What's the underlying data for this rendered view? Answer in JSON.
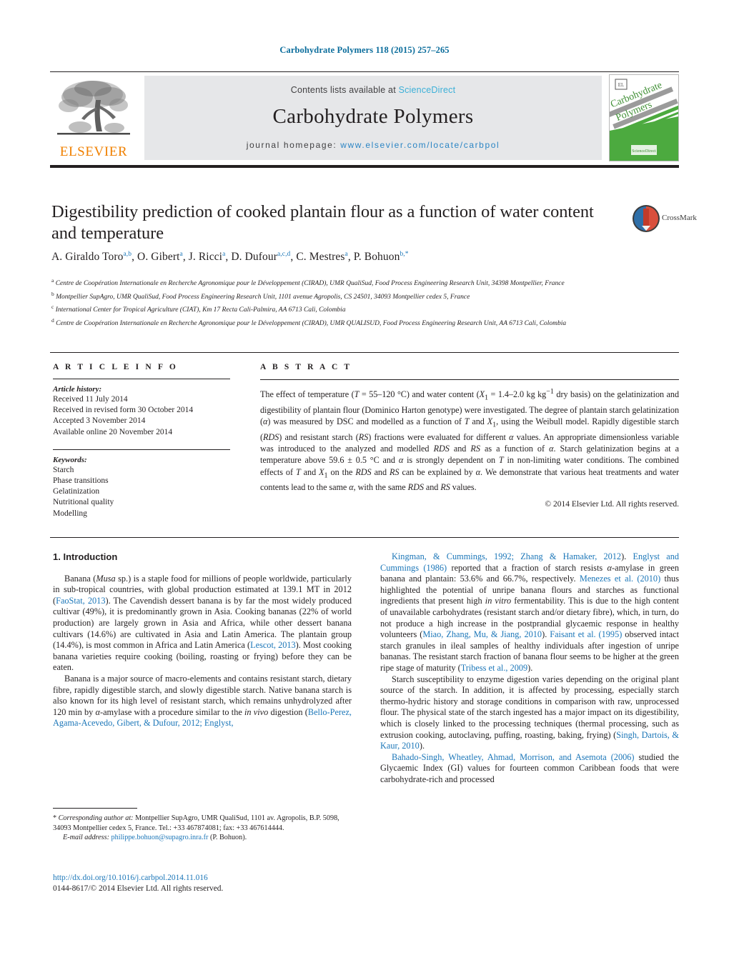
{
  "running_head": "Carbohydrate Polymers 118 (2015) 257–265",
  "masthead": {
    "publisher_name": "ELSEVIER",
    "contents_prefix": "Contents lists available at",
    "contents_link": "ScienceDirect",
    "journal_name": "Carbohydrate Polymers",
    "homepage_prefix": "journal homepage:",
    "homepage_url": "www.elsevier.com/locate/carbpol",
    "cover_title_line1": "Carbohydrate",
    "cover_title_line2": "Polymers"
  },
  "article": {
    "title": "Digestibility prediction of cooked plantain flour as a function of water content and temperature",
    "crossmark_label": "CrossMark",
    "authors_html": "A. Giraldo Toro<sup>a,b</sup>, O. Gibert<sup>a</sup>, J. Ricci<sup>a</sup>, D. Dufour<sup>a,c,d</sup>, C. Mestres<sup>a</sup>, P. Bohuon<sup>b,*</sup>",
    "affiliations": [
      {
        "mark": "a",
        "text": "Centre de Coopération Internationale en Recherche Agronomique pour le Développement (CIRAD), UMR QualiSud, Food Process Engineering Research Unit, 34398 Montpellier, France"
      },
      {
        "mark": "b",
        "text": "Montpellier SupAgro, UMR QualiSud, Food Process Engineering Research Unit, 1101 avenue Agropolis, CS 24501, 34093 Montpellier cedex 5, France"
      },
      {
        "mark": "c",
        "text": "International Center for Tropical Agriculture (CIAT), Km 17 Recta Cali-Palmira, AA 6713 Cali, Colombia"
      },
      {
        "mark": "d",
        "text": "Centre de Coopération Internationale en Recherche Agronomique pour le Développement (CIRAD), UMR QUALISUD, Food Process Engineering Research Unit, AA 6713 Cali, Colombia"
      }
    ]
  },
  "article_info": {
    "heading": "A R T I C L E    I N F O",
    "history_label": "Article history:",
    "history": [
      "Received 11 July 2014",
      "Received in revised form 30 October 2014",
      "Accepted 3 November 2014",
      "Available online 20 November 2014"
    ],
    "keywords_label": "Keywords:",
    "keywords": [
      "Starch",
      "Phase transitions",
      "Gelatinization",
      "Nutritional quality",
      "Modelling"
    ]
  },
  "abstract": {
    "heading": "A B S T R A C T",
    "body_html": "The effect of temperature (<i>T</i> = 55–120 °C) and water content (<i>X</i><sub>1</sub> = 1.4–2.0 kg kg<sup>−1</sup> dry basis) on the gelatinization and digestibility of plantain flour (Dominico Harton genotype) were investigated. The degree of plantain starch gelatinization (<i>α</i>) was measured by DSC and modelled as a function of <i>T</i> and <i>X</i><sub>1</sub>, using the Weibull model. Rapidly digestible starch (<i>RDS</i>) and resistant starch (<i>RS</i>) fractions were evaluated for different <i>α</i> values. An appropriate dimensionless variable was introduced to the analyzed and modelled <i>RDS</i> and <i>RS</i> as a function of <i>α</i>. Starch gelatinization begins at a temperature above 59.6 ± 0.5 °C and <i>α</i> is strongly dependent on <i>T</i> in non-limiting water conditions. The combined effects of <i>T</i> and <i>X</i><sub>1</sub> on the <i>RDS</i> and <i>RS</i> can be explained by <i>α</i>. We demonstrate that various heat treatments and water contents lead to the same <i>α</i>, with the same <i>RDS</i> and <i>RS</i> values.",
    "copyright": "© 2014 Elsevier Ltd. All rights reserved."
  },
  "introduction": {
    "section_number_title": "1.  Introduction",
    "left_paragraphs_html": [
      "Banana (<i>Musa</i> sp.) is a staple food for millions of people worldwide, particularly in sub-tropical countries, with global production estimated at 139.1 MT in 2012 (<span class=\"ref\">FaoStat, 2013</span>). The Cavendish dessert banana is by far the most widely produced cultivar (49%), it is predominantly grown in Asia. Cooking bananas (22% of world production) are largely grown in Asia and Africa, while other dessert banana cultivars (14.6%) are cultivated in Asia and Latin America. The plantain group (14.4%), is most common in Africa and Latin America (<span class=\"ref\">Lescot, 2013</span>). Most cooking banana varieties require cooking (boiling, roasting or frying) before they can be eaten.",
      "Banana is a major source of macro-elements and contains resistant starch, dietary fibre, rapidly digestible starch, and slowly digestible starch. Native banana starch is also known for its high level of resistant starch, which remains unhydrolyzed after 120 min by <i>α</i>-amylase with a procedure similar to the <i>in vivo</i> digestion (<span class=\"ref\">Bello-Perez, Agama-Acevedo, Gibert, &amp; Dufour, 2012; Englyst,</span>"
    ],
    "right_paragraphs_html": [
      "<span class=\"ref\">Kingman, &amp; Cummings, 1992; Zhang &amp; Hamaker, 2012</span>). <span class=\"ref\">Englyst and Cummings (1986)</span> reported that a fraction of starch resists <i>α</i>-amylase in green banana and plantain: 53.6% and 66.7%, respectively. <span class=\"ref\">Menezes et al. (2010)</span> thus highlighted the potential of unripe banana flours and starches as functional ingredients that present high <i>in vitro</i> fermentability. This is due to the high content of unavailable carbohydrates (resistant starch and/or dietary fibre), which, in turn, do not produce a high increase in the postprandial glycaemic response in healthy volunteers (<span class=\"ref\">Miao, Zhang, Mu, &amp; Jiang, 2010</span>). <span class=\"ref\">Faisant et al. (1995)</span> observed intact starch granules in ileal samples of healthy individuals after ingestion of unripe bananas. The resistant starch fraction of banana flour seems to be higher at the green ripe stage of maturity (<span class=\"ref\">Tribess et al., 2009</span>).",
      "Starch susceptibility to enzyme digestion varies depending on the original plant source of the starch. In addition, it is affected by processing, especially starch thermo-hydric history and storage conditions in comparison with raw, unprocessed flour. The physical state of the starch ingested has a major impact on its digestibility, which is closely linked to the processing techniques (thermal processing, such as extrusion cooking, autoclaving, puffing, roasting, baking, frying) (<span class=\"ref\">Singh, Dartois, &amp; Kaur, 2010</span>).",
      "<span class=\"ref\">Bahado-Singh, Wheatley, Ahmad, Morrison, and Asemota (2006)</span> studied the Glycaemic Index (GI) values for fourteen common Caribbean foods that were carbohydrate-rich and processed"
    ]
  },
  "footnote": {
    "corresponding_html": "* <i>Corresponding author at:</i> Montpellier SupAgro, UMR QualiSud, 1101 av. Agropolis, B.P. 5098, 34093 Montpellier cedex 5, France. Tel.: +33 467874081; fax: +33 467614444.",
    "email_label": "E-mail address:",
    "email": "philippe.bohuon@supagro.inra.fr",
    "email_owner": "(P. Bohuon)."
  },
  "footer": {
    "doi": "http://dx.doi.org/10.1016/j.carbpol.2014.11.016",
    "issn_line": "0144-8617/© 2014 Elsevier Ltd. All rights reserved."
  },
  "colors": {
    "link_blue": "#1b76b8",
    "running_head_blue": "#0b6d9c",
    "elsevier_orange": "#f08000",
    "masthead_grey": "#e6e7e9",
    "cover_green": "#4caa3f"
  }
}
